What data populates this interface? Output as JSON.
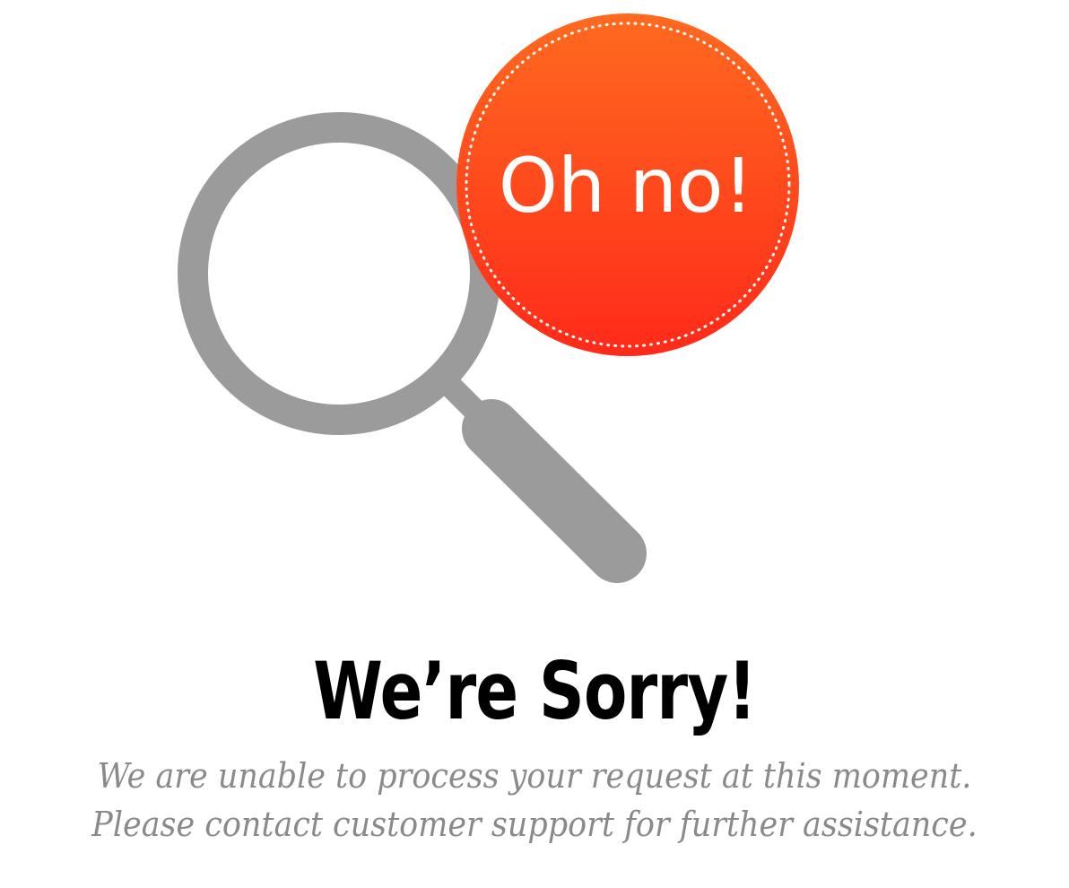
{
  "badge": {
    "text": "Oh no!"
  },
  "heading": "We’re Sorry!",
  "message": "We are unable to process your request at this moment. Please contact customer support for further assistance.",
  "icons": {
    "magnifier": "magnifying-glass-icon",
    "badge": "oh-no-badge-icon"
  },
  "colors": {
    "magnifier": "#9b9b9b",
    "badge_top": "#ff6a1f",
    "badge_bottom": "#ff2a1a",
    "heading": "#000000",
    "message": "#8a8a8a",
    "background": "#ffffff"
  }
}
